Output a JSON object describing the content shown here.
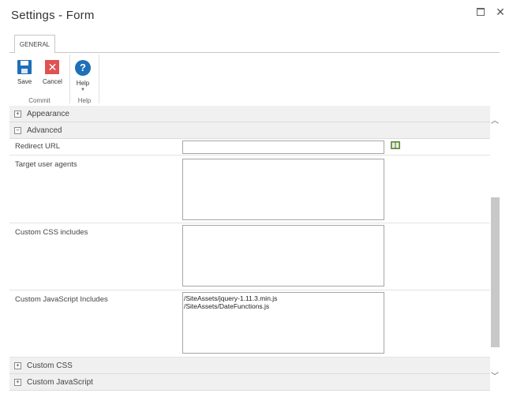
{
  "window": {
    "title": "Settings - Form"
  },
  "ribbon": {
    "tab_label": "GENERAL",
    "commit": {
      "save_label": "Save",
      "cancel_label": "Cancel",
      "group_label": "Commit"
    },
    "help": {
      "help_label": "Help",
      "group_label": "Help"
    }
  },
  "sections": {
    "appearance": {
      "label": "Appearance",
      "toggle": "+"
    },
    "advanced": {
      "label": "Advanced",
      "toggle": "−"
    },
    "custom_css": {
      "label": "Custom CSS",
      "toggle": "+"
    },
    "custom_js": {
      "label": "Custom JavaScript",
      "toggle": "+"
    }
  },
  "fields": {
    "redirect_url": {
      "label": "Redirect URL",
      "value": ""
    },
    "target_user_agents": {
      "label": "Target user agents",
      "value": ""
    },
    "custom_css_includes": {
      "label": "Custom CSS includes",
      "value": ""
    },
    "custom_js_includes": {
      "label": "Custom JavaScript Includes",
      "value": "/SiteAssets/jquery-1.11.3.min.js\n/SiteAssets/DateFunctions.js"
    }
  },
  "icons": {
    "maximize": "maximize-icon",
    "close": "close-icon",
    "save": "save-icon",
    "cancel": "cancel-icon",
    "help": "help-icon",
    "lookup": "address-book-icon"
  },
  "colors": {
    "accent": "#1f6fb7",
    "cancel": "#e05252",
    "section_bg": "#f0f0f0"
  }
}
